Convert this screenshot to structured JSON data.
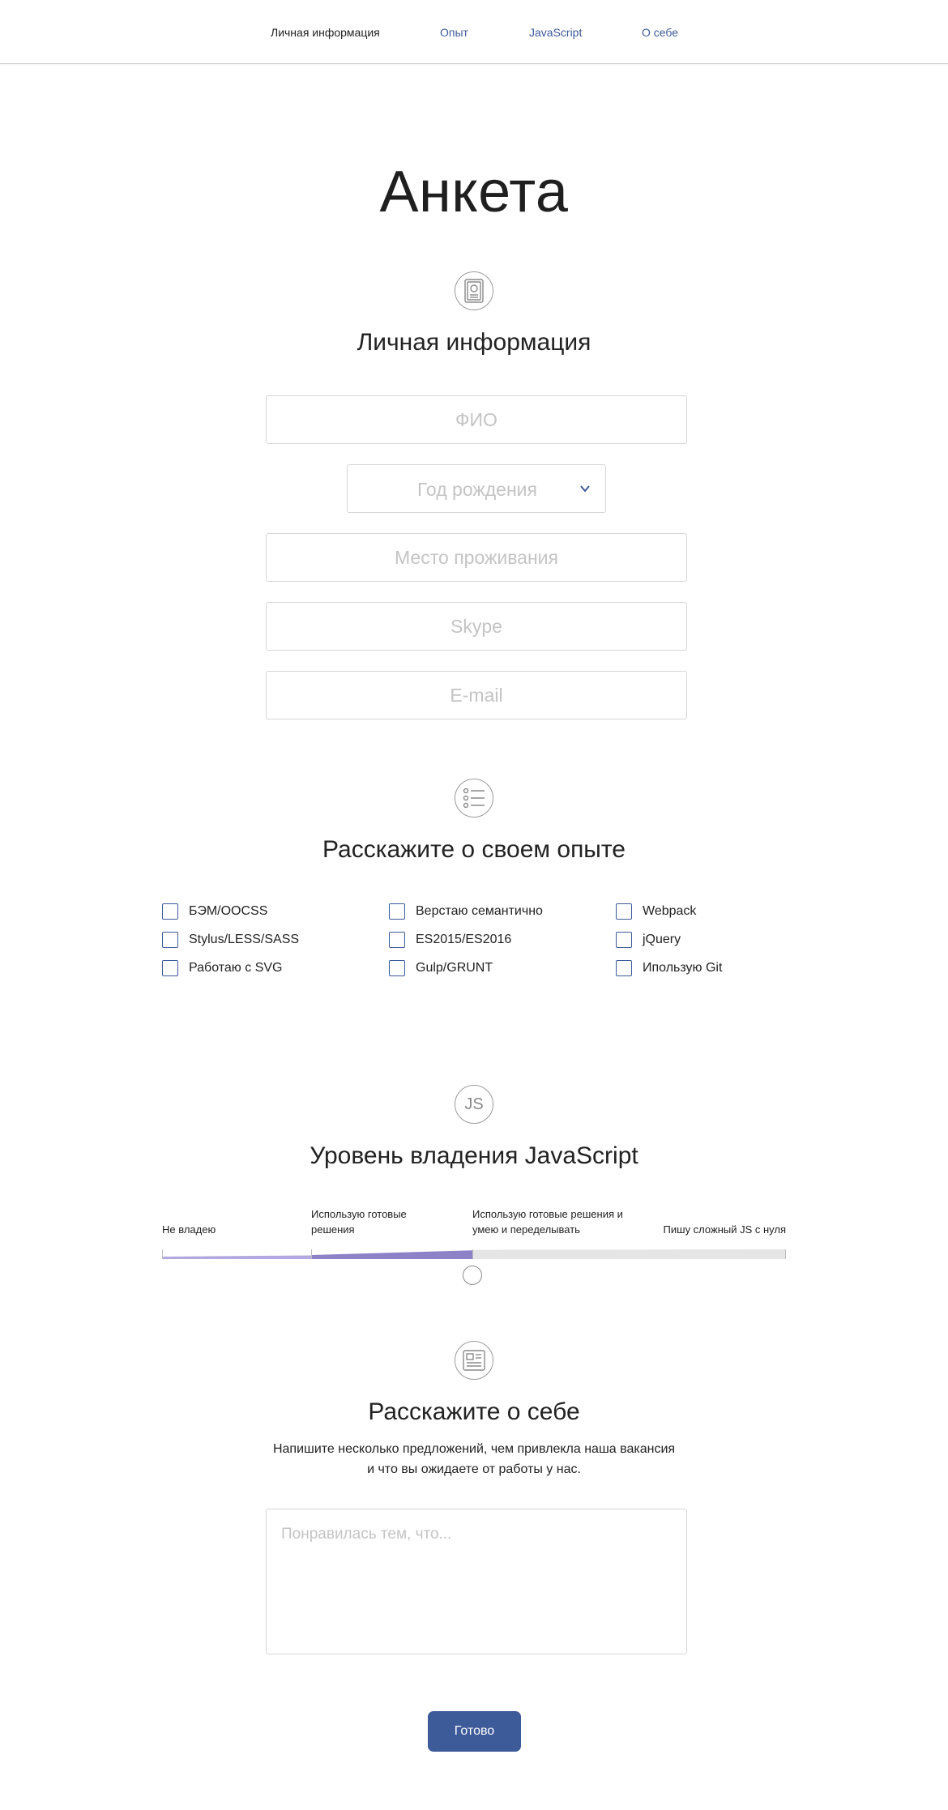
{
  "nav": {
    "items": [
      {
        "label": "Личная информация",
        "active": true
      },
      {
        "label": "Опыт",
        "active": false
      },
      {
        "label": "JavaScript",
        "active": false
      },
      {
        "label": "О себе",
        "active": false
      }
    ]
  },
  "page": {
    "title": "Анкета"
  },
  "personal": {
    "icon": "id-card-icon",
    "title": "Личная информация",
    "fio_placeholder": "ФИО",
    "birth_year_placeholder": "Год рождения",
    "residence_placeholder": "Место проживания",
    "skype_placeholder": "Skype",
    "email_placeholder": "E-mail"
  },
  "experience": {
    "icon": "list-icon",
    "title": "Расскажите о своем опыте",
    "checkboxes": [
      {
        "label": "БЭМ/OOCSS",
        "checked": false
      },
      {
        "label": "Stylus/LESS/SASS",
        "checked": false
      },
      {
        "label": "Работаю с SVG",
        "checked": false
      },
      {
        "label": "Верстаю семантично",
        "checked": false
      },
      {
        "label": "ES2015/ES2016",
        "checked": false
      },
      {
        "label": "Gulp/GRUNT",
        "checked": false
      },
      {
        "label": "Webpack",
        "checked": false
      },
      {
        "label": "jQuery",
        "checked": false
      },
      {
        "label": "Ипользую Git",
        "checked": false
      }
    ]
  },
  "javascript": {
    "icon": "js-icon",
    "icon_text": "JS",
    "title": "Уровень владения JavaScript",
    "levels": [
      {
        "label": "Не владею"
      },
      {
        "label": "Использую готовые решения"
      },
      {
        "label": "Использую готовые решения и умею и переделывать"
      },
      {
        "label": "Пишу сложный JS с нуля"
      }
    ],
    "selected_level_index": 2
  },
  "about": {
    "icon": "document-icon",
    "title": "Расскажите о себе",
    "description_line1": "Напишите несколько предложений, чем привлекла наша вакансия",
    "description_line2": "и что вы ожидаете от работы у нас.",
    "textarea_placeholder": "Понравилась тем, что..."
  },
  "submit": {
    "label": "Готово"
  },
  "colors": {
    "accent": "#3d5a99",
    "slider_fill": "#8d82c8",
    "slider_fill_light": "#b3a9e0",
    "slider_track": "#e5e5e5"
  }
}
